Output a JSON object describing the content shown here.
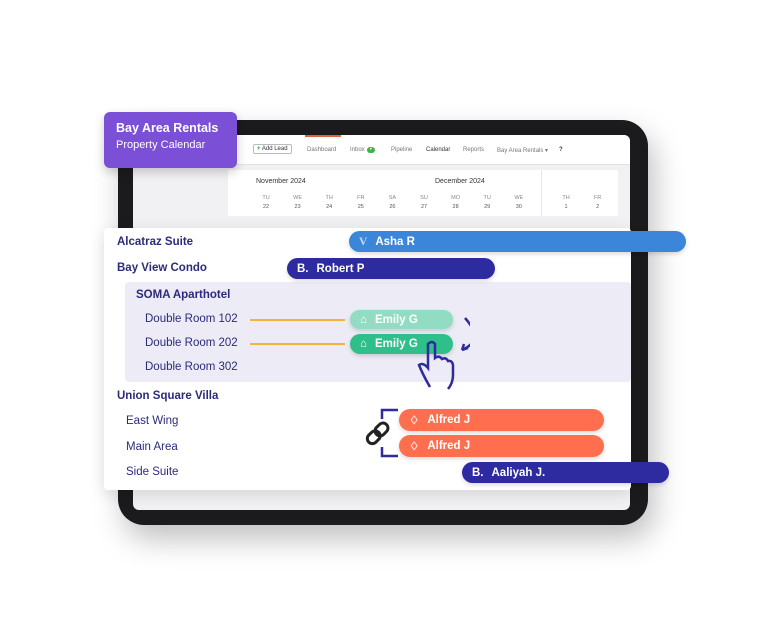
{
  "tag": {
    "title": "Bay Area Rentals",
    "subtitle": "Property Calendar"
  },
  "nav": {
    "add_lead": "Add Lead",
    "items": [
      "Dashboard",
      "Inbox",
      "Pipeline",
      "Calendar",
      "Reports",
      "Bay Area Rentals ▾"
    ],
    "active": "Calendar",
    "help": "?"
  },
  "calendar": {
    "months": [
      "November 2024",
      "December 2024"
    ],
    "days": [
      [
        "TU",
        "22"
      ],
      [
        "WE",
        "23"
      ],
      [
        "TH",
        "24"
      ],
      [
        "FR",
        "25"
      ],
      [
        "SA",
        "26"
      ],
      [
        "SU",
        "27"
      ],
      [
        "MO",
        "28"
      ],
      [
        "TU",
        "29"
      ],
      [
        "WE",
        "30"
      ],
      [
        "TH",
        "1"
      ],
      [
        "FR",
        "2"
      ]
    ],
    "prev": "‹",
    "next": "›"
  },
  "properties": {
    "alcatraz": "Alcatraz Suite",
    "bayview": "Bay View Condo",
    "soma": "SOMA Aparthotel",
    "soma_rooms": [
      "Double Room 102",
      "Double Room 202",
      "Double Room 302"
    ],
    "union": "Union Square Villa",
    "union_rooms": [
      "East Wing",
      "Main Area",
      "Side Suite"
    ]
  },
  "bookings": {
    "asha": {
      "guest": "Asha R",
      "source": "vrbo-icon",
      "color": "#3b86d8"
    },
    "robert": {
      "guest": "Robert P",
      "source": "booking-icon",
      "color": "#2e2aa0"
    },
    "emily1": {
      "guest": "Emily G",
      "source": "hostaway-icon",
      "color": "#93dcc4"
    },
    "emily2": {
      "guest": "Emily G",
      "source": "hostaway-icon",
      "color": "#2fbf8a"
    },
    "alfred1": {
      "guest": "Alfred J",
      "source": "airbnb-icon",
      "color": "#ff6f4f"
    },
    "alfred2": {
      "guest": "Alfred J",
      "source": "airbnb-icon",
      "color": "#ff6f4f"
    },
    "aaliyah": {
      "guest": "Aaliyah J.",
      "source": "booking-icon",
      "color": "#2e2aa0"
    }
  },
  "icons": {
    "booking": "B."
  }
}
